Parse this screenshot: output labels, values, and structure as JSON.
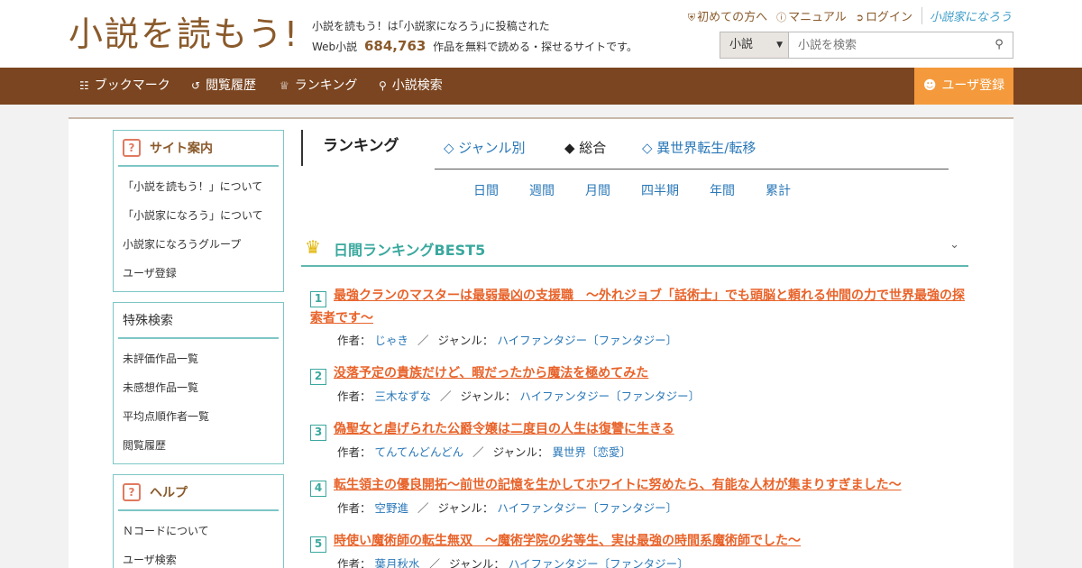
{
  "header": {
    "logo_text": "小説を読もう!",
    "tagline_line1": "小説を読もう！は｢小説家になろう｣に投稿された",
    "tagline_prefix": "Web小説",
    "tagline_count": "684,763",
    "tagline_suffix": "作品を無料で読める・探せるサイトです。",
    "top_links": {
      "first_time": "初めての方へ",
      "manual": "マニュアル",
      "login": "ログイン",
      "naro_logo": "小説家になろう"
    },
    "search": {
      "select_value": "小説",
      "placeholder": "小説を検索"
    }
  },
  "nav": {
    "bookmark": "ブックマーク",
    "history": "閲覧履歴",
    "ranking": "ランキング",
    "search": "小説検索",
    "register": "ユーザ登録"
  },
  "sidebar": {
    "site_guide": {
      "title": "サイト案内",
      "items": [
        "「小説を読もう！」について",
        "「小説家になろう」について",
        "小説家になろうグループ",
        "ユーザ登録"
      ]
    },
    "special_search": {
      "title": "特殊検索",
      "items": [
        "未評価作品一覧",
        "未感想作品一覧",
        "平均点順作者一覧",
        "閲覧履歴"
      ]
    },
    "help": {
      "title": "ヘルプ",
      "items": [
        "Ｎコードについて",
        "ユーザ検索"
      ]
    }
  },
  "ranking": {
    "title": "ランキング",
    "tabs": [
      "◇ ジャンル別",
      "◆ 総合",
      "◇ 異世界転生/転移"
    ],
    "periods": [
      "日間",
      "週間",
      "月間",
      "四半期",
      "年間",
      "累計"
    ],
    "best_title": "日間ランキングBEST5",
    "author_label": "作者：",
    "genre_label": "ジャンル：",
    "separator": "／",
    "entries": [
      {
        "rank": "1",
        "title": "最強クランのマスターは最弱最凶の支援職　～外れジョブ「話術士」でも頭脳と頼れる仲間の力で世界最強の探索者です～",
        "author": "じゃき",
        "genre": "ハイファンタジー〔ファンタジー〕"
      },
      {
        "rank": "2",
        "title": "没落予定の貴族だけど、暇だったから魔法を極めてみた",
        "author": "三木なずな",
        "genre": "ハイファンタジー〔ファンタジー〕"
      },
      {
        "rank": "3",
        "title": "偽聖女と虐げられた公爵令嬢は二度目の人生は復讐に生きる",
        "author": "てんてんどんどん",
        "genre": "異世界〔恋愛〕"
      },
      {
        "rank": "4",
        "title": "転生領主の優良開拓〜前世の記憶を生かしてホワイトに努めたら、有能な人材が集まりすぎました〜",
        "author": "空野進",
        "genre": "ハイファンタジー〔ファンタジー〕"
      },
      {
        "rank": "5",
        "title": "時使い魔術師の転生無双　～魔術学院の劣等生、実は最強の時間系魔術師でした～",
        "author": "葉月秋水",
        "genre": "ハイファンタジー〔ファンタジー〕"
      }
    ]
  }
}
